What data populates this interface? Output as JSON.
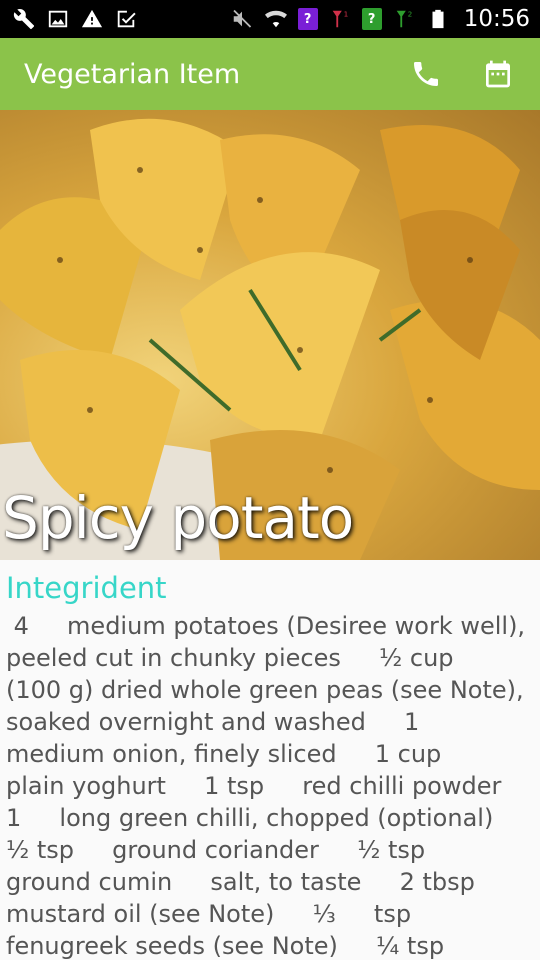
{
  "status_bar": {
    "time": "10:56",
    "icons": [
      "wrench-icon",
      "image-icon",
      "warning-icon",
      "check-box-icon",
      "mute-icon",
      "wifi-icon",
      "sim1-unknown-icon",
      "signal1-icon",
      "sim2-unknown-icon",
      "signal2-icon",
      "battery-icon"
    ]
  },
  "app_bar": {
    "title": "Vegetarian Item",
    "actions": [
      "phone-icon",
      "calendar-icon"
    ],
    "color": "#8bc34a"
  },
  "hero": {
    "title": "Spicy potato"
  },
  "content": {
    "heading": "Integrident",
    "heading_color": "#37d6c8",
    "ingredients": " 4     medium potatoes (Desiree work well), peeled cut in chunky pieces     ½ cup     (100 g) dried whole green peas (see Note), soaked overnight and washed     1     medium onion, finely sliced     1 cup     plain yoghurt     1 tsp     red chilli powder     1     long green chilli, chopped (optional)     ½ tsp     ground coriander     ½ tsp     ground cumin     salt, to taste     2 tbsp     mustard oil (see Note)     ⅓     tsp     fenugreek seeds (see Note)     ¼ tsp     turmeric powder"
  }
}
